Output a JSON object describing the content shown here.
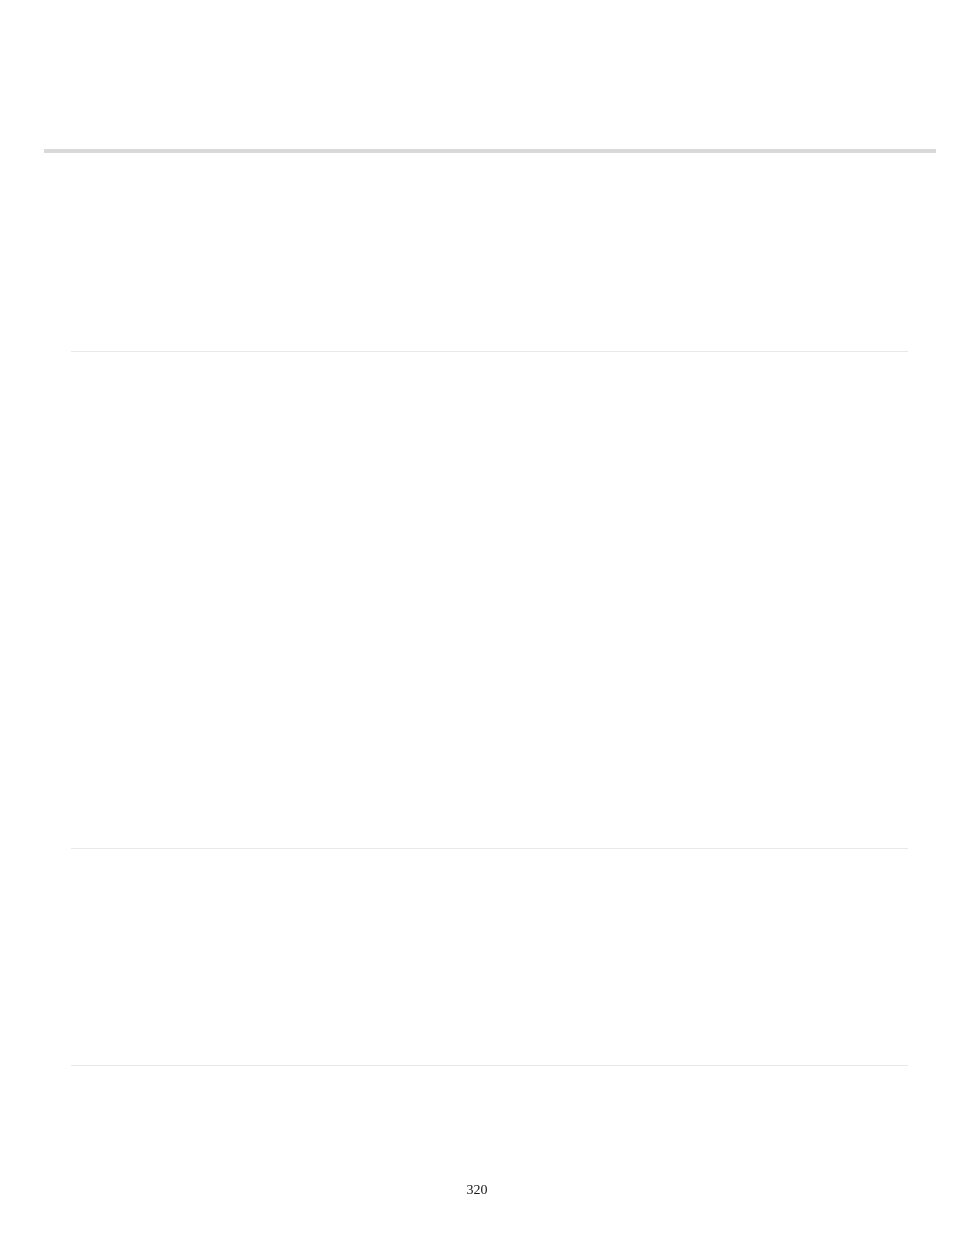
{
  "footer": {
    "page_number": "320"
  }
}
